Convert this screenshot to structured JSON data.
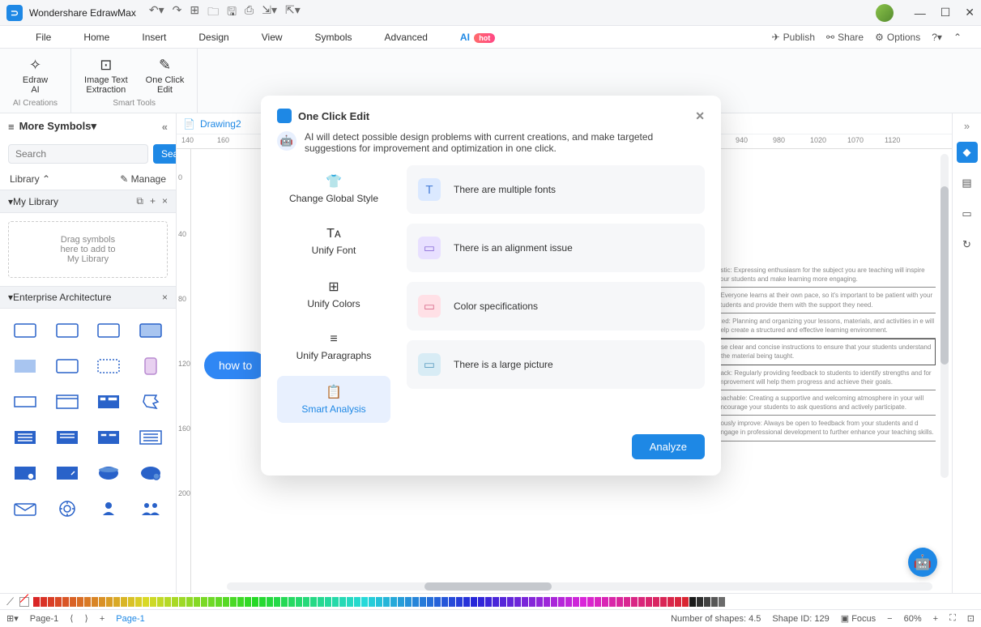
{
  "app": {
    "name": "Wondershare EdrawMax"
  },
  "menus": {
    "items": [
      "File",
      "Home",
      "Insert",
      "Design",
      "View",
      "Symbols",
      "Advanced",
      "AI"
    ],
    "active": "AI",
    "hot_badge": "hot",
    "right": {
      "publish": "Publish",
      "share": "Share",
      "options": "Options"
    }
  },
  "ribbon": {
    "group1_label": "AI Creations",
    "group2_label": "Smart Tools",
    "edraw_ai": "Edraw\nAI",
    "image_text": "Image Text\nExtraction",
    "one_click": "One Click\nEdit"
  },
  "sidebar": {
    "title": "More Symbols",
    "search_placeholder": "Search",
    "search_btn": "Search",
    "library_label": "Library",
    "manage_label": "Manage",
    "my_library": "My Library",
    "dropzone": "Drag symbols\nhere to add to\nMy Library",
    "enterprise": "Enterprise Architecture"
  },
  "tab": {
    "name": "Drawing2"
  },
  "ruler_h": [
    "140",
    "160",
    "940",
    "980",
    "1020",
    "1070",
    "1120"
  ],
  "ruler_v": [
    "0",
    "40",
    "80",
    "120",
    "160",
    "200"
  ],
  "chip": "how to",
  "bg_lines": [
    "astic: Expressing enthusiasm for the subject you are teaching will inspire your students and make learning more engaging.",
    ": Everyone learns at their own pace, so it's important to be patient with your students and provide them with the support they need.",
    "ized: Planning and organizing your lessons, materials, and activities in e will help create a structured and effective learning environment.",
    "se clear and concise instructions to ensure that your students understand the material being taught.",
    "back: Regularly providing feedback to students to identify strengths and for improvement will help them progress and achieve their goals.",
    "roachable: Creating a supportive and welcoming atmosphere in your will encourage your students to ask questions and actively participate.",
    "uously improve: Always be open to feedback from your students and d engage in professional development to further enhance your teaching skills."
  ],
  "modal": {
    "title": "One Click Edit",
    "desc": "AI will detect possible design problems with current creations, and make targeted suggestions for improvement and optimization in one click.",
    "left": [
      {
        "label": "Change Global Style",
        "icon": "👕"
      },
      {
        "label": "Unify Font",
        "icon": "Tᴀ"
      },
      {
        "label": "Unify Colors",
        "icon": "⊞"
      },
      {
        "label": "Unify Paragraphs",
        "icon": "≡"
      },
      {
        "label": "Smart Analysis",
        "icon": "📋"
      }
    ],
    "right": [
      {
        "label": "There are multiple fonts",
        "cls": "i-blue",
        "icon": "T"
      },
      {
        "label": "There is an alignment issue",
        "cls": "i-purple",
        "icon": "▭"
      },
      {
        "label": "Color specifications",
        "cls": "i-pink",
        "icon": "▭"
      },
      {
        "label": "There is a large picture",
        "cls": "i-teal",
        "icon": "▭"
      }
    ],
    "analyze": "Analyze"
  },
  "status": {
    "page_tab": "Page-1",
    "page_name": "Page-1",
    "shapes": "Number of shapes: 4.5",
    "shape_id": "Shape ID: 129",
    "focus": "Focus",
    "zoom": "60%"
  }
}
